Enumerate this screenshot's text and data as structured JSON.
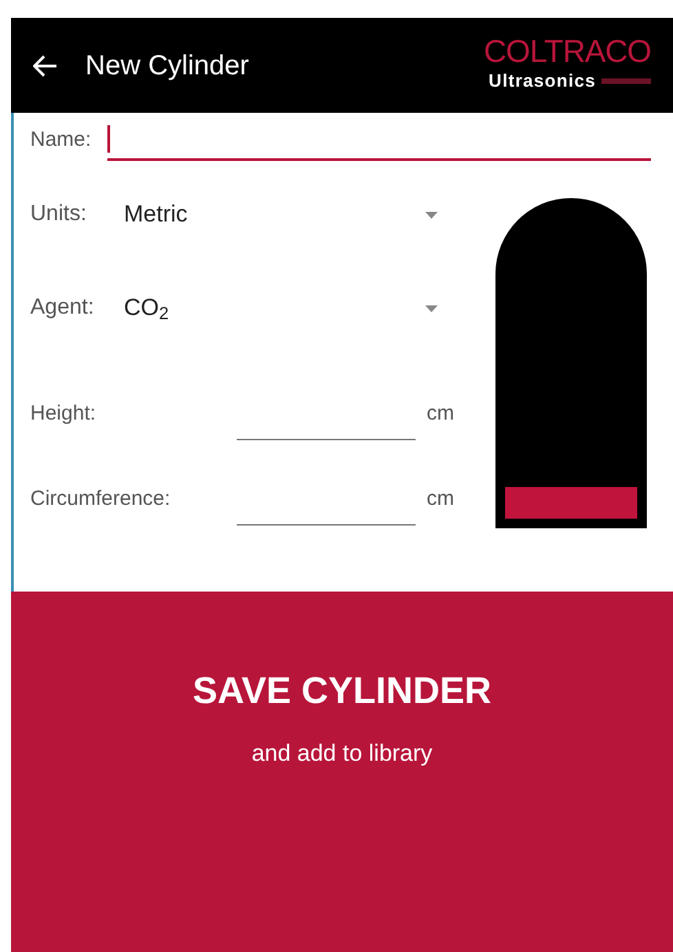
{
  "header": {
    "title": "New Cylinder",
    "logo": {
      "brand": "COLTRACO",
      "subtitle": "Ultrasonics"
    }
  },
  "form": {
    "name": {
      "label": "Name:",
      "focused": true
    },
    "units": {
      "label": "Units:",
      "value": "Metric"
    },
    "agent": {
      "label": "Agent:",
      "value": "CO$_{2}$"
    },
    "height": {
      "label": "Height:",
      "unit": "cm"
    },
    "circumference": {
      "label": "Circumference:",
      "unit": "cm"
    }
  },
  "cylinder": {
    "level": 0.1
  },
  "save": {
    "title": "SAVE CYLINDER",
    "subtitle": "and add to library"
  }
}
